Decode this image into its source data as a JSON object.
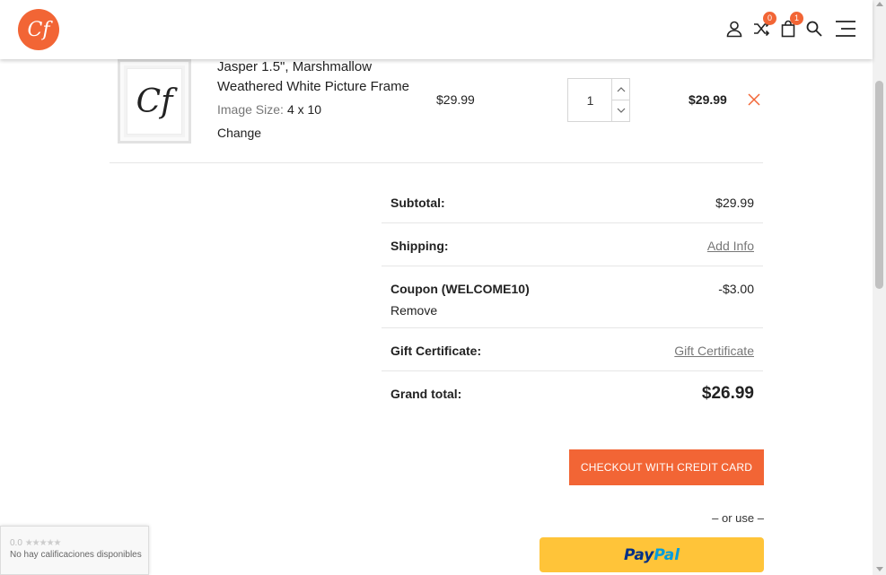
{
  "colors": {
    "accent": "#f26535",
    "paypal_yellow": "#ffc439",
    "paypal_dark_blue": "#003087",
    "paypal_light_blue": "#009cde"
  },
  "header": {
    "logo_text": "Cf",
    "icons": [
      "account-icon",
      "compare-icon",
      "cart-icon",
      "search-icon",
      "menu-icon"
    ],
    "compare_count": "0",
    "cart_count": "1"
  },
  "product": {
    "name": "Jasper 1.5\", Marshmallow Weathered White Picture Frame",
    "thumbnail_text": "Cf",
    "image_size_label": "Image Size:",
    "image_size_value": "4 x 10",
    "change_label": "Change",
    "unit_price": "$29.99",
    "quantity": "1",
    "line_total": "$29.99"
  },
  "totals": {
    "subtotal_label": "Subtotal:",
    "subtotal_value": "$29.99",
    "shipping_label": "Shipping:",
    "shipping_value": "Add Info",
    "coupon_label": "Coupon (WELCOME10)",
    "coupon_value": "-$3.00",
    "coupon_remove": "Remove",
    "gift_label": "Gift Certificate:",
    "gift_value": "Gift Certificate",
    "grand_label": "Grand total:",
    "grand_value": "$26.99"
  },
  "actions": {
    "checkout_label": "CHECKOUT WITH CREDIT CARD",
    "or_use": "– or use –",
    "paypal_part1": "Pay",
    "paypal_part2": "Pal"
  },
  "rating_widget": {
    "score": "0.0",
    "stars": "★★★★★",
    "text": "No hay calificaciones disponibles"
  }
}
